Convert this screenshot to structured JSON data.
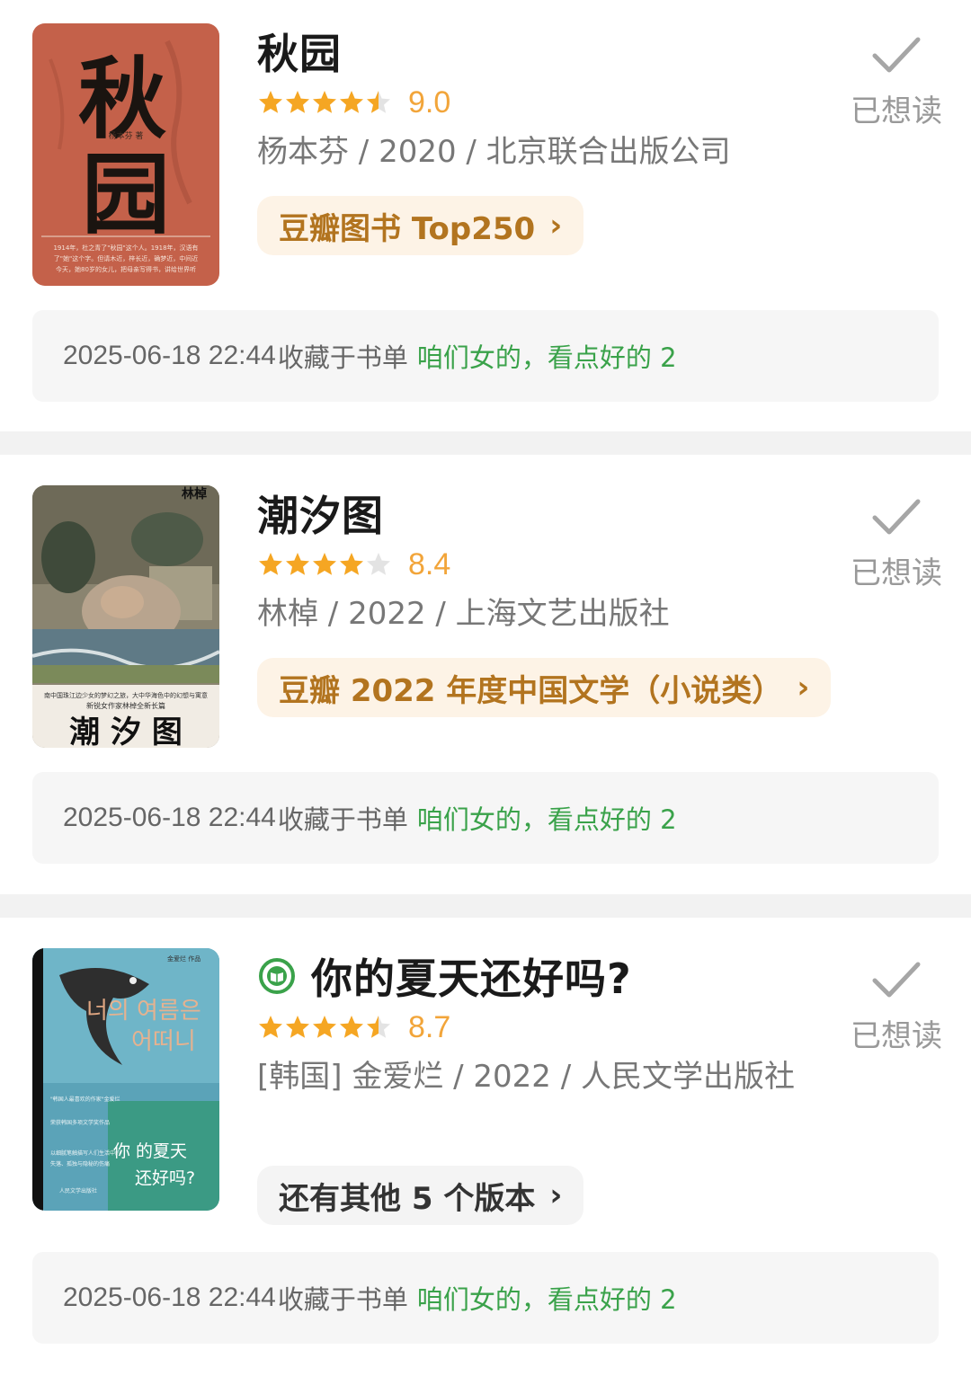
{
  "books": [
    {
      "title": "秋园",
      "score": "9.0",
      "rating": 4.5,
      "meta": "杨本芬 / 2020 / 北京联合出版公司",
      "tag": "豆瓣图书 Top250",
      "want_label": "已想读",
      "note_date": "2025-06-18 22:44",
      "note_saved": "收藏于书单",
      "note_list": "咱们女的，看点好的 2",
      "cover": {
        "title_text": "秋园",
        "author": "杨本芬 著",
        "bg": "#c9664f"
      }
    },
    {
      "title": "潮汐图",
      "score": "8.4",
      "rating": 4.0,
      "meta": "林棹 / 2022 / 上海文艺出版社",
      "tag": "豆瓣 2022 年度中国文学（小说类）",
      "want_label": "已想读",
      "note_date": "2025-06-18 22:44",
      "note_saved": "收藏于书单",
      "note_list": "咱们女的，看点好的 2",
      "cover": {
        "title_text": "潮 汐 图",
        "author": "林棹"
      }
    },
    {
      "title": "你的夏天还好吗?",
      "score": "8.7",
      "rating": 4.5,
      "meta": "[韩国] 金爱烂 / 2022 / 人民文学出版社",
      "tag": "还有其他 5 个版本",
      "want_label": "已想读",
      "note_date": "2025-06-18 22:44",
      "note_saved": "收藏于书单",
      "note_list": "咱们女的，看点好的 2",
      "cover": {
        "korean": "너의 여름은 어떠니",
        "cn_title": "你 的夏天 还好吗?"
      }
    }
  ],
  "colors": {
    "star": "#f5a623",
    "star_empty": "#e3e3e3",
    "accent_green": "#3aa24a",
    "tag_bg": "#fdf3e6",
    "tag_text": "#b2741f"
  },
  "icons": {
    "check": "check-icon",
    "chevron": "chevron-right-icon",
    "ebook": "ebook-icon",
    "star": "star-icon"
  }
}
